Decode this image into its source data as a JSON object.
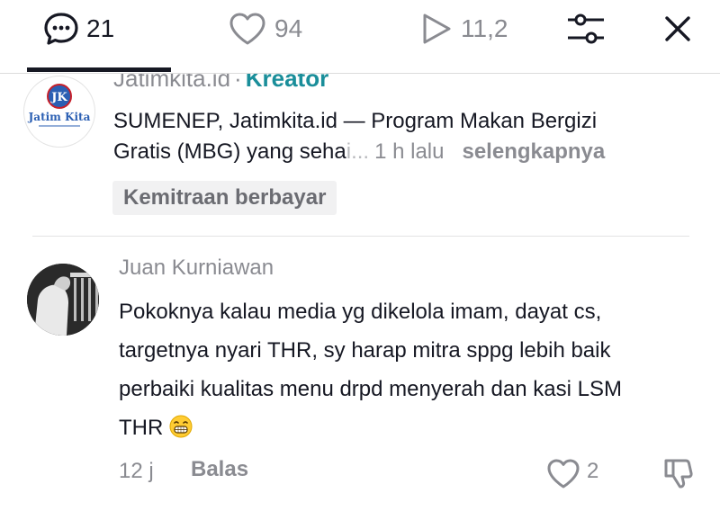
{
  "topbar": {
    "comments_count": "21",
    "likes_count": "94",
    "views_count": "11,2"
  },
  "post": {
    "avatar_text": "JK",
    "avatar_brand": "Jatim Kita",
    "author": "Jatimkita.id",
    "separator": "·",
    "badge": "Kreator",
    "text_line1": "SUMENEP, Jatimkita.id — Program Makan Bergizi",
    "text_line2": "Gratis (MBG) yang seha",
    "text_fade": "i...",
    "time": "1 h lalu",
    "more_label": "selengkapnya",
    "partner_tag": "Kemitraan berbayar"
  },
  "comment": {
    "author": "Juan Kurniawan",
    "text_line1": "Pokoknya kalau media yg dikelola imam, dayat cs,",
    "text_line2": "targetnya nyari THR, sy harap mitra sppg lebih baik",
    "text_line3": "perbaiki kualitas menu drpd menyerah dan kasi LSM",
    "text_line4": "THR",
    "emoji": "grinning-face-emoji",
    "time_ago": "12 j",
    "reply_label": "Balas",
    "like_count": "2"
  },
  "icons": {
    "comments": "speech-bubble-dots-icon",
    "likes": "heart-outline-icon",
    "views": "play-outline-icon",
    "filter": "sliders-icon",
    "close": "close-icon",
    "comment_like": "heart-outline-icon",
    "comment_dislike": "thumb-down-icon"
  },
  "colors": {
    "text": "#161823",
    "muted": "#8a8b91",
    "kreator_badge": "#1a8e9a",
    "brand_red": "#c8202a",
    "brand_blue": "#2b5fb3"
  }
}
